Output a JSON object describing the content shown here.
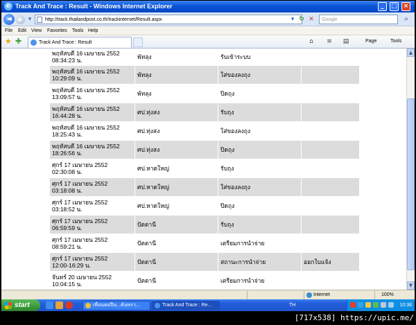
{
  "window": {
    "title": "Track And Trace : Result - Windows Internet Explorer",
    "controls": {
      "minimize": "_",
      "maximize": "□",
      "close": "×"
    }
  },
  "address_bar": {
    "url": "http://track.thailandpost.co.th/trackinternet/Result.aspx",
    "search_placeholder": "Google"
  },
  "menu": [
    "File",
    "Edit",
    "View",
    "Favorites",
    "Tools",
    "Help"
  ],
  "command_bar": {
    "tab_label": "Track And Trace : Result",
    "page_label": "Page",
    "tools_label": "Tools"
  },
  "tracking_rows": [
    {
      "datetime": [
        "พฤหัสบดี 16 เมษายน 2552",
        "08:34:23 น."
      ],
      "location": "พัทลุง",
      "status": "รับเข้าระบบ",
      "note": ""
    },
    {
      "datetime": [
        "พฤหัสบดี 16 เมษายน 2552",
        "10:29:09 น."
      ],
      "location": "พัทลุง",
      "status": "ใส่ของลงถุง",
      "note": ""
    },
    {
      "datetime": [
        "พฤหัสบดี 16 เมษายน 2552",
        "13:09:57 น."
      ],
      "location": "พัทลุง",
      "status": "ปิดถุง",
      "note": ""
    },
    {
      "datetime": [
        "พฤหัสบดี 16 เมษายน 2552",
        "16:44:28 น."
      ],
      "location": "ศป.ทุ่งสง",
      "status": "รับถุง",
      "note": ""
    },
    {
      "datetime": [
        "พฤหัสบดี 16 เมษายน 2552",
        "18:25:43 น."
      ],
      "location": "ศป.ทุ่งสง",
      "status": "ใส่ของลงถุง",
      "note": ""
    },
    {
      "datetime": [
        "พฤหัสบดี 16 เมษายน 2552",
        "18:26:56 น."
      ],
      "location": "ศป.ทุ่งสง",
      "status": "ปิดถุง",
      "note": ""
    },
    {
      "datetime": [
        "ศุกร์ 17 เมษายน 2552",
        "02:30:08 น."
      ],
      "location": "ศป.หาดใหญ่",
      "status": "รับถุง",
      "note": ""
    },
    {
      "datetime": [
        "ศุกร์ 17 เมษายน 2552",
        "03:18:08 น."
      ],
      "location": "ศป.หาดใหญ่",
      "status": "ใส่ของลงถุง",
      "note": ""
    },
    {
      "datetime": [
        "ศุกร์ 17 เมษายน 2552",
        "03:18:52 น."
      ],
      "location": "ศป.หาดใหญ่",
      "status": "ปิดถุง",
      "note": ""
    },
    {
      "datetime": [
        "ศุกร์ 17 เมษายน 2552",
        "06:59:59 น."
      ],
      "location": "ปัตตานี",
      "status": "รับถุง",
      "note": ""
    },
    {
      "datetime": [
        "ศุกร์ 17 เมษายน 2552",
        "08:59:21 น."
      ],
      "location": "ปัตตานี",
      "status": "เตรียมการนำจ่าย",
      "note": ""
    },
    {
      "datetime": [
        "ศุกร์ 17 เมษายน 2552",
        "12:00-16:29 น."
      ],
      "location": "ปัตตานี",
      "status": "สถานะการนำจ่าย",
      "note": "ออกใบแจ้ง"
    },
    {
      "datetime": [
        "จันทร์ 20 เมษายน 2552",
        "10:04:15 น."
      ],
      "location": "ปัตตานี",
      "status": "เตรียมการนำจ่าย",
      "note": ""
    }
  ],
  "status_bar": {
    "zone": "Internet",
    "zoom": "100%"
  },
  "taskbar": {
    "start_label": "start",
    "tasks": [
      "เพื่อนคอปืน...ค้นหรว...",
      "Track And Trace : Re..."
    ],
    "language": "TH",
    "clock": "10:38"
  },
  "watermark": "[717x538] https://upic.me/"
}
